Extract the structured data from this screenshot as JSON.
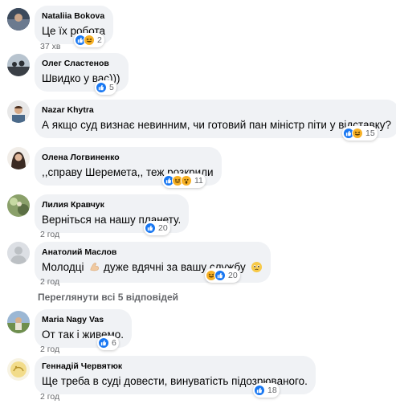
{
  "comments": [
    {
      "author": "Nataliia Bokova",
      "text": "Це їх робота",
      "time": "37 хв",
      "reactions_count": "2"
    },
    {
      "author": "Олег Сластенов",
      "text": "Швидко у вас)))",
      "time": "",
      "reactions_count": "5"
    },
    {
      "author": "Nazar Khytra",
      "text": "А якщо суд визнає невинним, чи готовий пан міністр піти у відставку?",
      "time": "",
      "reactions_count": "15"
    },
    {
      "author": "Олена Логвиненко",
      "text": ",,справу Шеремета,, теж розкрили",
      "time": "",
      "reactions_count": "11"
    },
    {
      "author": "Лилия Кравчук",
      "text": "Верніться на нашу планету.",
      "time": "2 год",
      "reactions_count": "20"
    },
    {
      "author": "Анатолий Маслов",
      "text_before": "Молодці",
      "text_after": "дуже вдячні за вашу службу",
      "time": "2 год",
      "reactions_count": "20"
    },
    {
      "author": "Maria Nagy Vas",
      "text": "От так і живемо.",
      "time": "2 год",
      "reactions_count": "6"
    },
    {
      "author": "Геннадій Червятюк",
      "text": "Ще треба в суді довести, винуватість підозрюваного.",
      "time": "2 год",
      "reactions_count": "18"
    }
  ],
  "view_more_replies": "Переглянути всі 5 відповідей",
  "colors": {
    "bubble": "#f0f2f5",
    "like": "#1877f2",
    "haha": "#f7b125",
    "meta_text": "#65676b"
  },
  "icons": [
    "like-reaction-icon",
    "haha-reaction-icon",
    "wow-reaction-icon",
    "muscle-emoji-icon",
    "pleading-emoji-icon"
  ]
}
